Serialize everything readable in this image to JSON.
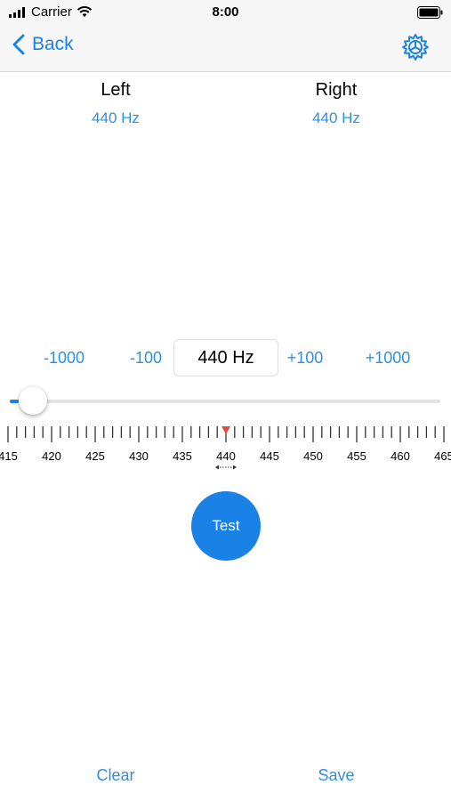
{
  "status_bar": {
    "carrier": "Carrier",
    "time": "8:00",
    "signal_icon": "signal-bars-icon",
    "wifi_icon": "wifi-icon",
    "battery_icon": "battery-icon"
  },
  "nav": {
    "back_label": "Back",
    "back_icon": "chevron-left-icon",
    "settings_icon": "gear-icon"
  },
  "channels": {
    "left": {
      "name": "Left",
      "frequency": "440 Hz"
    },
    "right": {
      "name": "Right",
      "frequency": "440 Hz"
    }
  },
  "controls": {
    "minus_1000": "-1000",
    "minus_100": "-100",
    "frequency": "440 Hz",
    "plus_100": "+100",
    "plus_1000": "+1000"
  },
  "slider": {
    "value_fraction": 0.02
  },
  "ruler": {
    "labels": [
      "415",
      "420",
      "425",
      "430",
      "435",
      "440",
      "445",
      "450",
      "455",
      "460",
      "465"
    ],
    "selected": "440",
    "marker_color": "#e84a3c",
    "marker_icon": "marker-triangle-icon",
    "drag_hint_icon": "double-arrow-icon"
  },
  "test_button": {
    "label": "Test"
  },
  "bottom": {
    "clear_label": "Clear",
    "save_label": "Save"
  },
  "colors": {
    "accent": "#1a82e6",
    "link": "#2e8fe0"
  }
}
